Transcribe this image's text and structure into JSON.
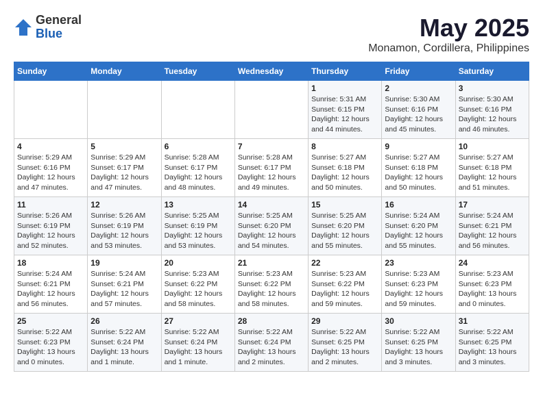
{
  "logo": {
    "general": "General",
    "blue": "Blue"
  },
  "title": "May 2025",
  "subtitle": "Monamon, Cordillera, Philippines",
  "weekdays": [
    "Sunday",
    "Monday",
    "Tuesday",
    "Wednesday",
    "Thursday",
    "Friday",
    "Saturday"
  ],
  "weeks": [
    [
      {
        "day": "",
        "info": ""
      },
      {
        "day": "",
        "info": ""
      },
      {
        "day": "",
        "info": ""
      },
      {
        "day": "",
        "info": ""
      },
      {
        "day": "1",
        "info": "Sunrise: 5:31 AM\nSunset: 6:15 PM\nDaylight: 12 hours\nand 44 minutes."
      },
      {
        "day": "2",
        "info": "Sunrise: 5:30 AM\nSunset: 6:16 PM\nDaylight: 12 hours\nand 45 minutes."
      },
      {
        "day": "3",
        "info": "Sunrise: 5:30 AM\nSunset: 6:16 PM\nDaylight: 12 hours\nand 46 minutes."
      }
    ],
    [
      {
        "day": "4",
        "info": "Sunrise: 5:29 AM\nSunset: 6:16 PM\nDaylight: 12 hours\nand 47 minutes."
      },
      {
        "day": "5",
        "info": "Sunrise: 5:29 AM\nSunset: 6:17 PM\nDaylight: 12 hours\nand 47 minutes."
      },
      {
        "day": "6",
        "info": "Sunrise: 5:28 AM\nSunset: 6:17 PM\nDaylight: 12 hours\nand 48 minutes."
      },
      {
        "day": "7",
        "info": "Sunrise: 5:28 AM\nSunset: 6:17 PM\nDaylight: 12 hours\nand 49 minutes."
      },
      {
        "day": "8",
        "info": "Sunrise: 5:27 AM\nSunset: 6:18 PM\nDaylight: 12 hours\nand 50 minutes."
      },
      {
        "day": "9",
        "info": "Sunrise: 5:27 AM\nSunset: 6:18 PM\nDaylight: 12 hours\nand 50 minutes."
      },
      {
        "day": "10",
        "info": "Sunrise: 5:27 AM\nSunset: 6:18 PM\nDaylight: 12 hours\nand 51 minutes."
      }
    ],
    [
      {
        "day": "11",
        "info": "Sunrise: 5:26 AM\nSunset: 6:19 PM\nDaylight: 12 hours\nand 52 minutes."
      },
      {
        "day": "12",
        "info": "Sunrise: 5:26 AM\nSunset: 6:19 PM\nDaylight: 12 hours\nand 53 minutes."
      },
      {
        "day": "13",
        "info": "Sunrise: 5:25 AM\nSunset: 6:19 PM\nDaylight: 12 hours\nand 53 minutes."
      },
      {
        "day": "14",
        "info": "Sunrise: 5:25 AM\nSunset: 6:20 PM\nDaylight: 12 hours\nand 54 minutes."
      },
      {
        "day": "15",
        "info": "Sunrise: 5:25 AM\nSunset: 6:20 PM\nDaylight: 12 hours\nand 55 minutes."
      },
      {
        "day": "16",
        "info": "Sunrise: 5:24 AM\nSunset: 6:20 PM\nDaylight: 12 hours\nand 55 minutes."
      },
      {
        "day": "17",
        "info": "Sunrise: 5:24 AM\nSunset: 6:21 PM\nDaylight: 12 hours\nand 56 minutes."
      }
    ],
    [
      {
        "day": "18",
        "info": "Sunrise: 5:24 AM\nSunset: 6:21 PM\nDaylight: 12 hours\nand 56 minutes."
      },
      {
        "day": "19",
        "info": "Sunrise: 5:24 AM\nSunset: 6:21 PM\nDaylight: 12 hours\nand 57 minutes."
      },
      {
        "day": "20",
        "info": "Sunrise: 5:23 AM\nSunset: 6:22 PM\nDaylight: 12 hours\nand 58 minutes."
      },
      {
        "day": "21",
        "info": "Sunrise: 5:23 AM\nSunset: 6:22 PM\nDaylight: 12 hours\nand 58 minutes."
      },
      {
        "day": "22",
        "info": "Sunrise: 5:23 AM\nSunset: 6:22 PM\nDaylight: 12 hours\nand 59 minutes."
      },
      {
        "day": "23",
        "info": "Sunrise: 5:23 AM\nSunset: 6:23 PM\nDaylight: 12 hours\nand 59 minutes."
      },
      {
        "day": "24",
        "info": "Sunrise: 5:23 AM\nSunset: 6:23 PM\nDaylight: 13 hours\nand 0 minutes."
      }
    ],
    [
      {
        "day": "25",
        "info": "Sunrise: 5:22 AM\nSunset: 6:23 PM\nDaylight: 13 hours\nand 0 minutes."
      },
      {
        "day": "26",
        "info": "Sunrise: 5:22 AM\nSunset: 6:24 PM\nDaylight: 13 hours\nand 1 minute."
      },
      {
        "day": "27",
        "info": "Sunrise: 5:22 AM\nSunset: 6:24 PM\nDaylight: 13 hours\nand 1 minute."
      },
      {
        "day": "28",
        "info": "Sunrise: 5:22 AM\nSunset: 6:24 PM\nDaylight: 13 hours\nand 2 minutes."
      },
      {
        "day": "29",
        "info": "Sunrise: 5:22 AM\nSunset: 6:25 PM\nDaylight: 13 hours\nand 2 minutes."
      },
      {
        "day": "30",
        "info": "Sunrise: 5:22 AM\nSunset: 6:25 PM\nDaylight: 13 hours\nand 3 minutes."
      },
      {
        "day": "31",
        "info": "Sunrise: 5:22 AM\nSunset: 6:25 PM\nDaylight: 13 hours\nand 3 minutes."
      }
    ]
  ]
}
